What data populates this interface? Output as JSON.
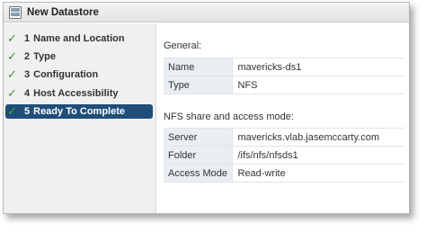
{
  "window": {
    "title": "New Datastore",
    "icon": "datastore-icon"
  },
  "steps": [
    {
      "number": "1",
      "label": "Name and Location",
      "completed": true,
      "active": false
    },
    {
      "number": "2",
      "label": "Type",
      "completed": true,
      "active": false
    },
    {
      "number": "3",
      "label": "Configuration",
      "completed": true,
      "active": false
    },
    {
      "number": "4",
      "label": "Host Accessibility",
      "completed": true,
      "active": false
    },
    {
      "number": "5",
      "label": "Ready To Complete",
      "completed": true,
      "active": true
    }
  ],
  "general": {
    "heading": "General:",
    "rows": [
      {
        "key": "Name",
        "value": "mavericks-ds1"
      },
      {
        "key": "Type",
        "value": "NFS"
      }
    ]
  },
  "nfs": {
    "heading": "NFS share and access mode:",
    "rows": [
      {
        "key": "Server",
        "value": "mavericks.vlab.jasemccarty.com"
      },
      {
        "key": "Folder",
        "value": "/ifs/nfs/nfsds1"
      },
      {
        "key": "Access Mode",
        "value": "Read-write"
      }
    ]
  },
  "colors": {
    "accent": "#1f4e79",
    "check": "#3a9a2b",
    "key_cell_bg": "#e9eef3"
  }
}
